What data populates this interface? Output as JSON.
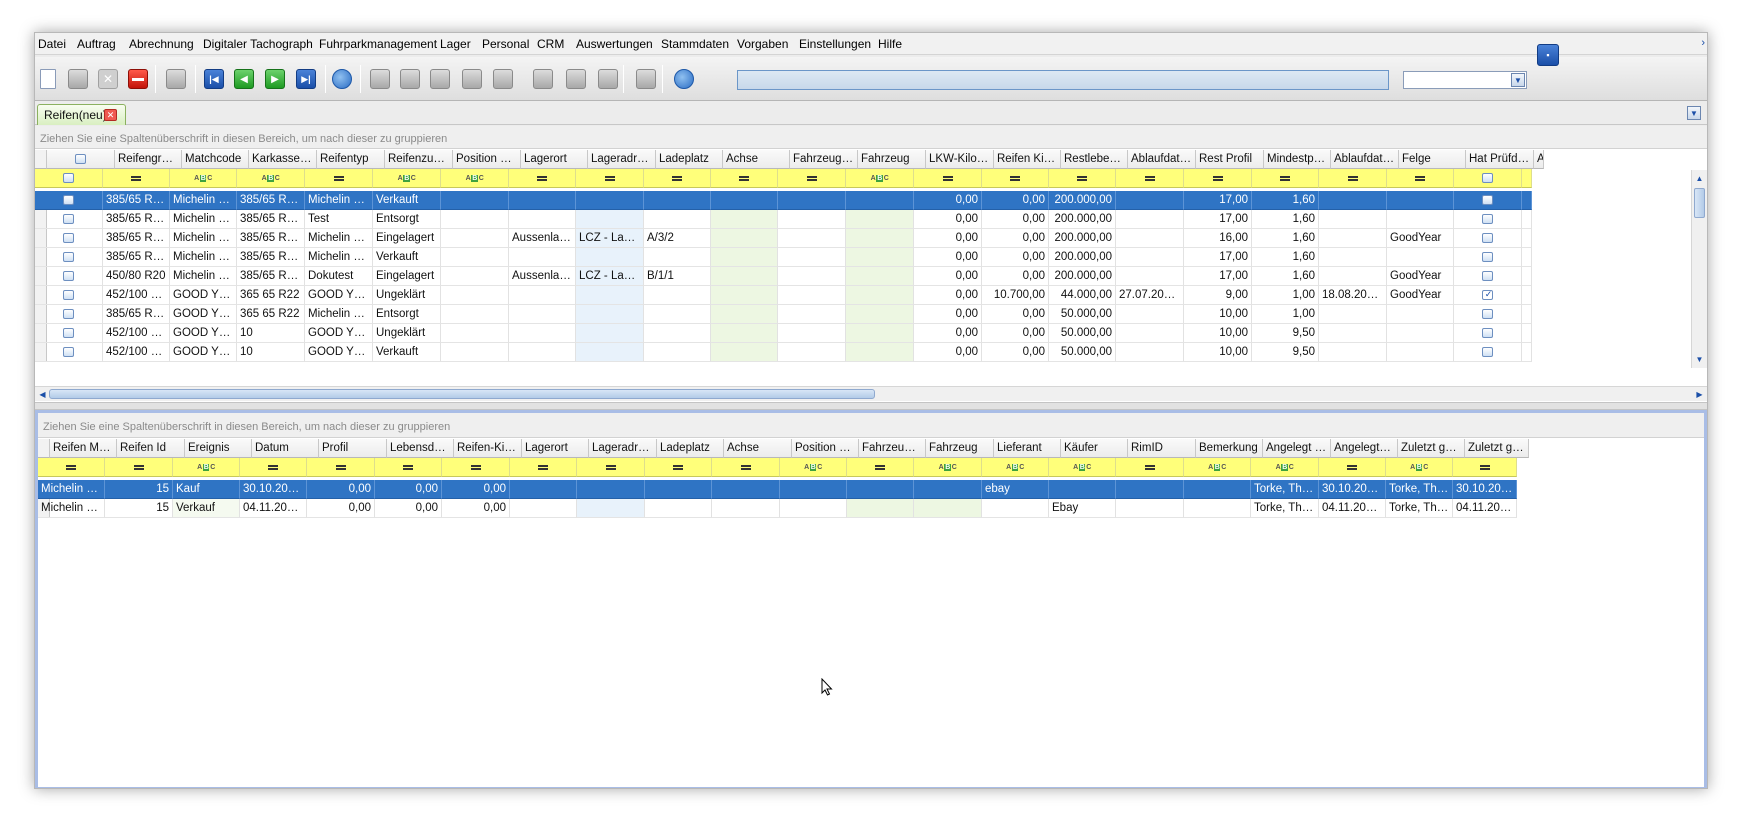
{
  "menu": [
    "Datei",
    "Auftrag",
    "Abrechnung",
    "Digitaler Tachograph",
    "Fuhrparkmanagement",
    "Lager",
    "Personal",
    "CRM",
    "Auswertungen",
    "Stammdaten",
    "Vorgaben",
    "Einstellungen",
    "Hilfe"
  ],
  "toolbar_icons": [
    "new-document-icon",
    "save-icon",
    "delete-icon",
    "close-red-icon",
    "copy-icon",
    "first-record-icon",
    "previous-record-icon",
    "next-record-icon",
    "last-record-icon",
    "refresh-icon",
    "print-icon",
    "barcode-icon",
    "barcode2-icon",
    "print-preview-icon",
    "print-setup-icon",
    "map-icon",
    "signpost-icon",
    "clock-icon",
    "settings-icon",
    "search-zoom-icon"
  ],
  "tab": {
    "label": "Reifen(neu)",
    "close": "✕"
  },
  "upper": {
    "group_hint": "Ziehen Sie eine Spaltenüberschrift in diesen Bereich, um nach dieser zu gruppieren",
    "columns": [
      "",
      "Reifengröße",
      "Matchcode",
      "Karkassen ...",
      "Reifentyp",
      "Reifenzusta...",
      "Position auf...",
      "Lagerort",
      "Lageradresse",
      "Ladeplatz",
      "Achse",
      "Fahrzeugtyp",
      "Fahrzeug",
      "LKW-Kilome...",
      "Reifen Kilom...",
      "Restlebens...",
      "Ablaufdatu...",
      "Rest Profil",
      "Mindestprofil",
      "Ablaufdatu...",
      "Felge",
      "Hat Prüfdat...",
      "A"
    ],
    "filters": [
      "cb",
      "eq",
      "abc",
      "abc",
      "eq",
      "abc",
      "abc",
      "eq",
      "eq",
      "eq",
      "eq",
      "eq",
      "abc",
      "eq",
      "eq",
      "eq",
      "eq",
      "eq",
      "eq",
      "eq",
      "eq",
      "cb",
      ""
    ],
    "rows": [
      {
        "cells": [
          "",
          "385/65 R22,5",
          "Michelin XTE...",
          "385/65 R22.5",
          "Michelin XTE 3",
          "Verkauft",
          "",
          "",
          "",
          "",
          "",
          "",
          "",
          "0,00",
          "0,00",
          "200.000,00",
          "",
          "17,00",
          "1,60",
          "",
          "",
          "",
          ""
        ],
        "checked": false
      },
      {
        "cells": [
          "",
          "385/65 R22,5",
          "Michelin XTE...",
          "385/65 R22.5",
          "Test",
          "Entsorgt",
          "",
          "",
          "",
          "",
          "",
          "",
          "",
          "0,00",
          "0,00",
          "200.000,00",
          "",
          "17,00",
          "1,60",
          "",
          "",
          "",
          ""
        ],
        "checked": false
      },
      {
        "cells": [
          "",
          "385/65 R22,5",
          "Michelin XTE...",
          "385/65 R22.5",
          "Michelin XTE 3",
          "Eingelagert",
          "",
          "Aussenlager",
          "LCZ - Lager...",
          "A/3/2",
          "",
          "",
          "",
          "0,00",
          "0,00",
          "200.000,00",
          "",
          "16,00",
          "1,60",
          "",
          "GoodYear",
          "",
          ""
        ],
        "checked": false
      },
      {
        "cells": [
          "",
          "385/65 R22,5",
          "Michelin XTE...",
          "385/65 R22.5",
          "Michelin XTE 3",
          "Verkauft",
          "",
          "",
          "",
          "",
          "",
          "",
          "",
          "0,00",
          "0,00",
          "200.000,00",
          "",
          "17,00",
          "1,60",
          "",
          "",
          "",
          ""
        ],
        "checked": false
      },
      {
        "cells": [
          "",
          "450/80 R20",
          "Michelin XTE...",
          "385/65 R22.5",
          "Dokutest",
          "Eingelagert",
          "",
          "Aussenlager",
          "LCZ - Lager...",
          "B/1/1",
          "",
          "",
          "",
          "0,00",
          "0,00",
          "200.000,00",
          "",
          "17,00",
          "1,60",
          "",
          "GoodYear",
          "",
          ""
        ],
        "checked": false
      },
      {
        "cells": [
          "",
          "452/100 R22",
          "GOOD YEA...",
          "365 65 R22",
          "GOOD YEA...",
          "Ungeklärt",
          "",
          "",
          "",
          "",
          "",
          "",
          "",
          "0,00",
          "10.700,00",
          "44.000,00",
          "27.07.2020...",
          "9,00",
          "1,00",
          "18.08.2020...",
          "GoodYear",
          "",
          ""
        ],
        "checked": true
      },
      {
        "cells": [
          "",
          "385/65 R22,5",
          "GOOD YEA...",
          "365 65 R22",
          "Michelin XTE 3",
          "Entsorgt",
          "",
          "",
          "",
          "",
          "",
          "",
          "",
          "0,00",
          "0,00",
          "50.000,00",
          "",
          "10,00",
          "1,00",
          "",
          "",
          "",
          ""
        ],
        "checked": false
      },
      {
        "cells": [
          "",
          "452/100 R22",
          "GOOD YEA...",
          "10",
          "GOOD YEA...",
          "Ungeklärt",
          "",
          "",
          "",
          "",
          "",
          "",
          "",
          "0,00",
          "0,00",
          "50.000,00",
          "",
          "10,00",
          "9,50",
          "",
          "",
          "",
          ""
        ],
        "checked": false
      },
      {
        "cells": [
          "",
          "452/100 R22",
          "GOOD YEA...",
          "10",
          "GOOD YEA...",
          "Verkauft",
          "",
          "",
          "",
          "",
          "",
          "",
          "",
          "0,00",
          "0,00",
          "50.000,00",
          "",
          "10,00",
          "9,50",
          "",
          "",
          "",
          ""
        ],
        "checked": false
      }
    ]
  },
  "lower": {
    "group_hint": "Ziehen Sie eine Spaltenüberschrift in diesen Bereich, um nach dieser zu gruppieren",
    "columns": [
      "Reifen Matc...",
      "Reifen Id",
      "Ereignis",
      "Datum",
      "Profil",
      "Lebensdaue...",
      "Reifen-Kilo...",
      "Lagerort",
      "Lageradresse",
      "Ladeplatz",
      "Achse",
      "Position auf...",
      "Fahrzeugtyp",
      "Fahrzeug",
      "Lieferant",
      "Käufer",
      "RimID",
      "Bemerkung",
      "Angelegt du...",
      "Angelegt am",
      "Zuletzt geä...",
      "Zuletzt geä..."
    ],
    "filters": [
      "eq",
      "eq",
      "abc",
      "eq",
      "eq",
      "eq",
      "eq",
      "eq",
      "eq",
      "eq",
      "eq",
      "abc",
      "eq",
      "abc",
      "abc",
      "abc",
      "eq",
      "abc",
      "abc",
      "eq",
      "abc",
      "eq"
    ],
    "rows": [
      [
        "Michelin XTE...",
        "15",
        "Kauf",
        "30.10.2019...",
        "0,00",
        "0,00",
        "0,00",
        "",
        "",
        "",
        "",
        "",
        "",
        "",
        "ebay",
        "",
        "",
        "",
        "Torke, Tho...",
        "30.10.2019...",
        "Torke, Tho...",
        "30.10.2019 ..."
      ],
      [
        "Michelin XTE...",
        "15",
        "Verkauf",
        "04.11.2019...",
        "0,00",
        "0,00",
        "0,00",
        "",
        "",
        "",
        "",
        "",
        "",
        "",
        "",
        "Ebay",
        "",
        "",
        "Torke, Tho...",
        "04.11.2019...",
        "Torke, Tho...",
        "04.11.2019 ..."
      ]
    ]
  }
}
